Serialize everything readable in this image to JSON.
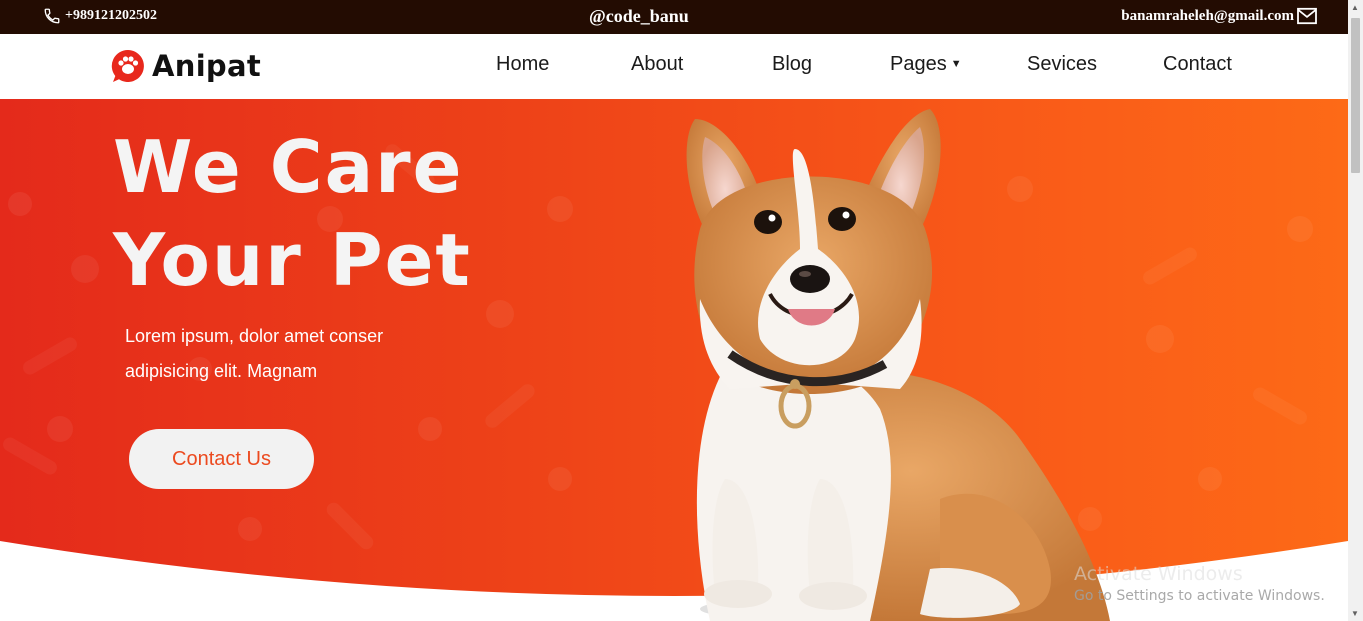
{
  "topbar": {
    "phone": "+989121202502",
    "handle": "@code_banu",
    "email": "banamraheleh@gmail.com",
    "phone_icon": "phone-icon",
    "mail_icon": "mail-icon"
  },
  "brand": {
    "name": "Anipat",
    "logo_icon": "pet-chat-logo-icon"
  },
  "nav": {
    "home": "Home",
    "about": "About",
    "blog": "Blog",
    "pages": "Pages",
    "services": "Sevices",
    "contact": "Contact"
  },
  "hero": {
    "title_line1": "We Care",
    "title_line2": "Your Pet",
    "subtitle_line1": "Lorem ipsum, dolor amet conser",
    "subtitle_line2": "adipisicing elit. Magnam",
    "cta": "Contact Us"
  },
  "watermark": {
    "line1": "Activate Windows",
    "line2": "Go to Settings to activate Windows."
  },
  "colors": {
    "topbar_bg": "#230c02",
    "hero_left": "#e42a1b",
    "hero_right": "#fd6a17",
    "cta_text": "#ec4a1f",
    "logo_red": "#e8281c"
  }
}
